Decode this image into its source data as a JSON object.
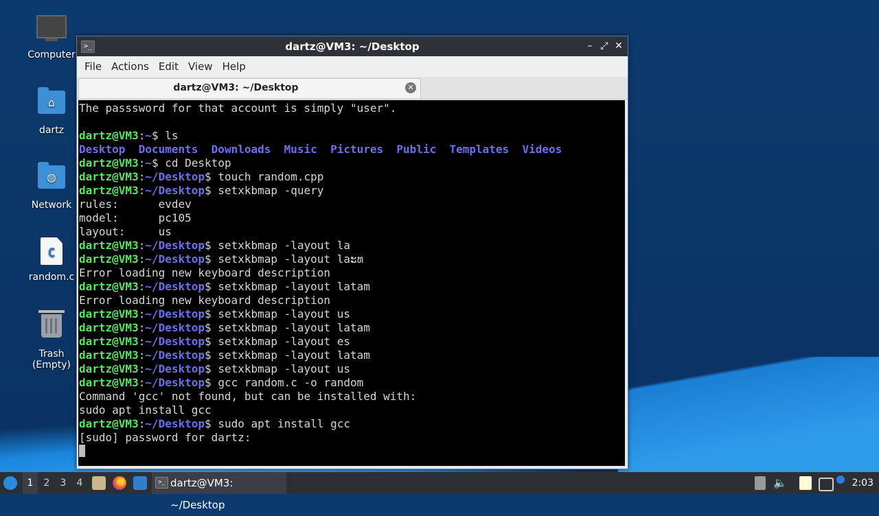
{
  "desktop": {
    "icons": [
      {
        "label": "Computer",
        "icon": "computer-icon"
      },
      {
        "label": "dartz",
        "icon": "home-folder-icon"
      },
      {
        "label": "Network",
        "icon": "network-folder-icon"
      },
      {
        "label": "random.c",
        "icon": "c-file-icon"
      },
      {
        "label": "Trash (Empty)",
        "icon": "trash-icon"
      }
    ]
  },
  "window": {
    "title": "dartz@VM3: ~/Desktop",
    "menu": [
      "File",
      "Actions",
      "Edit",
      "View",
      "Help"
    ],
    "tab_label": "dartz@VM3: ~/Desktop",
    "controls": {
      "minimize": "–",
      "maximize": "⤢",
      "close": "✕"
    }
  },
  "terminal": {
    "user_host": "dartz@VM3",
    "lines": [
      {
        "type": "text",
        "text": "The passsword for that account is simply \"user\"."
      },
      {
        "type": "text",
        "text": ""
      },
      {
        "type": "prompt",
        "path": "~",
        "cmd": "ls"
      },
      {
        "type": "dirs",
        "items": [
          "Desktop",
          "Documents",
          "Downloads",
          "Music",
          "Pictures",
          "Public",
          "Templates",
          "Videos"
        ]
      },
      {
        "type": "prompt",
        "path": "~",
        "cmd": "cd Desktop"
      },
      {
        "type": "prompt",
        "path": "~/Desktop",
        "cmd": "touch random.cpp"
      },
      {
        "type": "prompt",
        "path": "~/Desktop",
        "cmd": "setxkbmap -query"
      },
      {
        "type": "text",
        "text": "rules:      evdev"
      },
      {
        "type": "text",
        "text": "model:      pc105"
      },
      {
        "type": "text",
        "text": "layout:     us"
      },
      {
        "type": "prompt",
        "path": "~/Desktop",
        "cmd": "setxkbmap -layout la"
      },
      {
        "type": "prompt",
        "path": "~/Desktop",
        "cmd": "setxkbmap -layout laະທ"
      },
      {
        "type": "text",
        "text": "Error loading new keyboard description"
      },
      {
        "type": "prompt",
        "path": "~/Desktop",
        "cmd": "setxkbmap -layout latam"
      },
      {
        "type": "text",
        "text": "Error loading new keyboard description"
      },
      {
        "type": "prompt",
        "path": "~/Desktop",
        "cmd": "setxkbmap -layout us"
      },
      {
        "type": "prompt",
        "path": "~/Desktop",
        "cmd": "setxkbmap -layout latam"
      },
      {
        "type": "prompt",
        "path": "~/Desktop",
        "cmd": "setxkbmap -layout es"
      },
      {
        "type": "prompt",
        "path": "~/Desktop",
        "cmd": "setxkbmap -layout latam"
      },
      {
        "type": "prompt",
        "path": "~/Desktop",
        "cmd": "setxkbmap -layout us"
      },
      {
        "type": "prompt",
        "path": "~/Desktop",
        "cmd": "gcc random.c -o random"
      },
      {
        "type": "text",
        "text": "Command 'gcc' not found, but can be installed with:"
      },
      {
        "type": "text",
        "text": "sudo apt install gcc"
      },
      {
        "type": "prompt",
        "path": "~/Desktop",
        "cmd": "sudo apt install gcc"
      },
      {
        "type": "text",
        "text": "[sudo] password for dartz:"
      },
      {
        "type": "cursor"
      }
    ]
  },
  "taskbar": {
    "workspaces": [
      "1",
      "2",
      "3",
      "4"
    ],
    "active_workspace": "1",
    "launchers": [
      "menu-icon",
      "file-manager-icon",
      "firefox-icon",
      "desktop-icon"
    ],
    "task_label": "dartz@VM3: ~/Desktop",
    "tray": [
      "tray-notes-icon",
      "volume-icon",
      "clipboard-icon",
      "network-icon",
      "update-icon"
    ],
    "clock": "2:03"
  }
}
